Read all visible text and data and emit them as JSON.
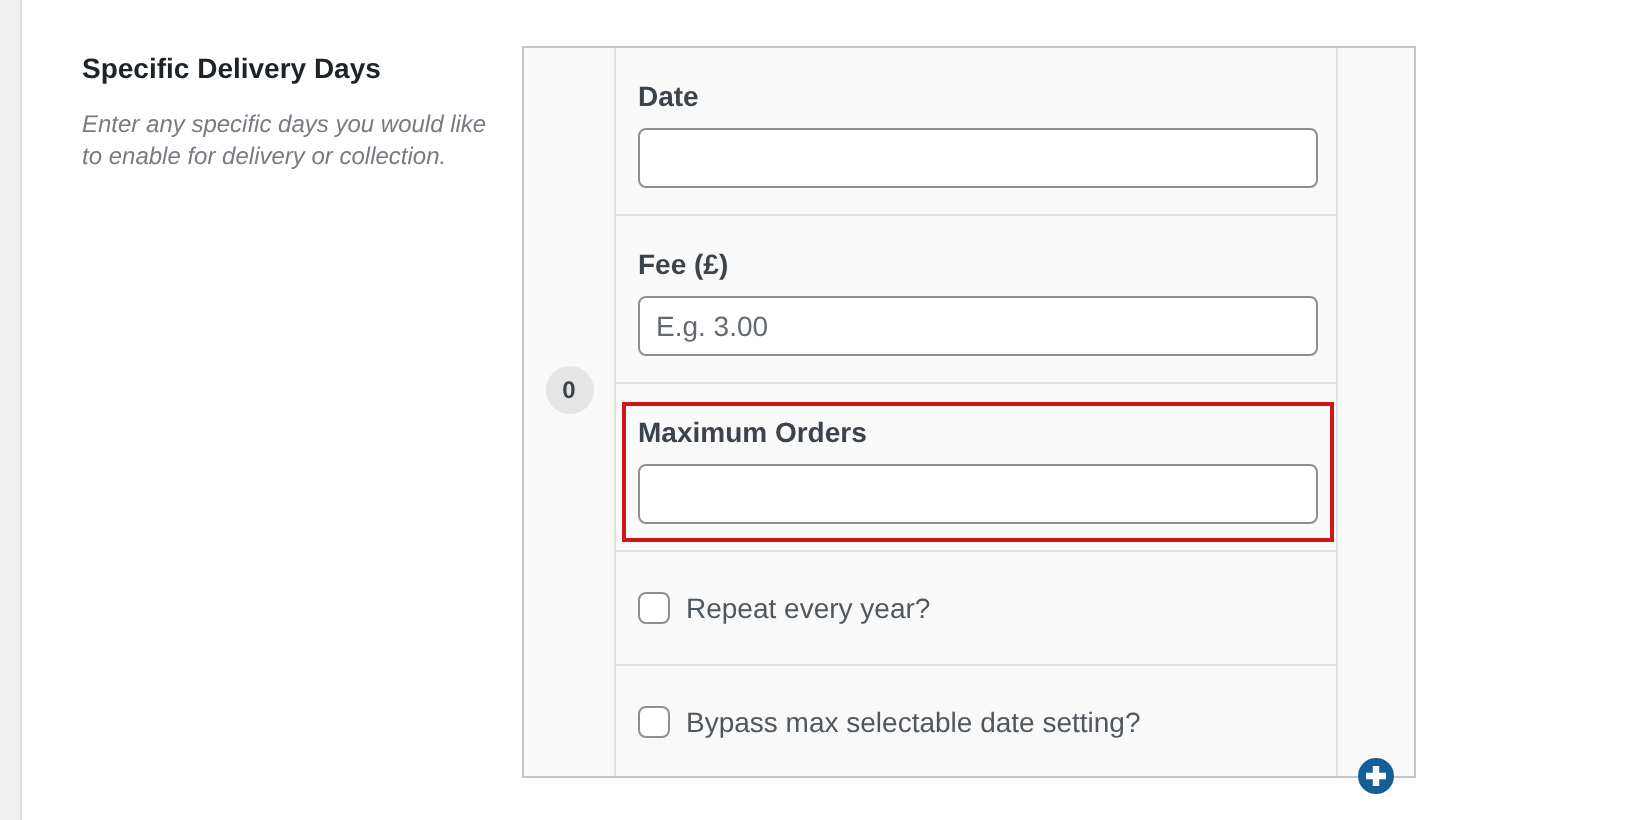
{
  "setting": {
    "title": "Specific Delivery Days",
    "description": "Enter any specific days you would like to enable for delivery or collection."
  },
  "repeater": {
    "rows": [
      {
        "index": "0",
        "fields": [
          {
            "kind": "text",
            "label": "Date",
            "highlighted": false
          },
          {
            "kind": "text",
            "label": "Fee (£)",
            "placeholder": "E.g. 3.00",
            "highlighted": false
          },
          {
            "kind": "text",
            "label": "Maximum Orders",
            "highlighted": true
          },
          {
            "kind": "checkbox",
            "label": "Repeat every year?",
            "checked": false
          },
          {
            "kind": "checkbox",
            "label": "Bypass max selectable date setting?",
            "checked": false
          }
        ]
      }
    ]
  }
}
